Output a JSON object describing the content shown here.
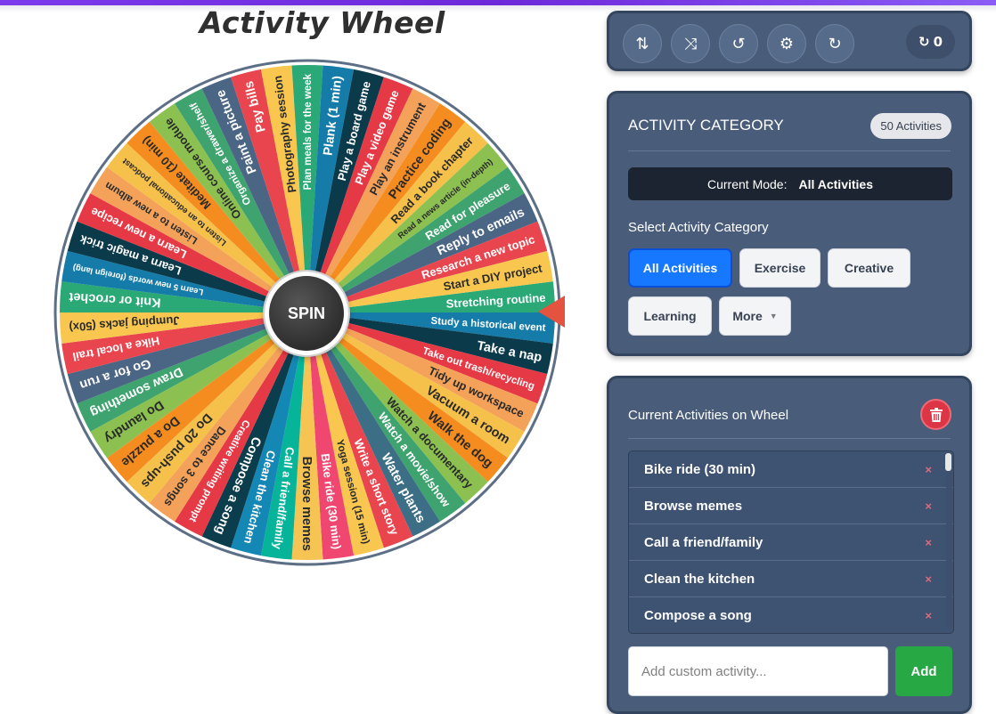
{
  "app": {
    "title": "Activity Wheel"
  },
  "wheel": {
    "spin_label": "SPIN",
    "segments": [
      {
        "label": "Stretching routine",
        "color": "#2aa876"
      },
      {
        "label": "Study a historical event",
        "color": "#157ba8"
      },
      {
        "label": "Take a nap",
        "color": "#0b3a4a"
      },
      {
        "label": "Take out trash/recycling",
        "color": "#e63946"
      },
      {
        "label": "Tidy up workspace",
        "color": "#f4a259"
      },
      {
        "label": "Vacuum a room",
        "color": "#f5c14a"
      },
      {
        "label": "Walk the dog",
        "color": "#f48c1f"
      },
      {
        "label": "Watch a documentary",
        "color": "#8cc152"
      },
      {
        "label": "Watch a movie/show",
        "color": "#3ea36e"
      },
      {
        "label": "Water plants",
        "color": "#3c6e86"
      },
      {
        "label": "Write a short story",
        "color": "#e8454f"
      },
      {
        "label": "Yoga session (15 min)",
        "color": "#f9c74f"
      },
      {
        "label": "Bike ride (30 min)",
        "color": "#ef476f"
      },
      {
        "label": "Browse memes",
        "color": "#f6c453"
      },
      {
        "label": "Call a friend/family",
        "color": "#06b49a"
      },
      {
        "label": "Clean the kitchen",
        "color": "#1587b5"
      },
      {
        "label": "Compose a song",
        "color": "#0b3d4c"
      },
      {
        "label": "Creative writing prompt",
        "color": "#e63946"
      },
      {
        "label": "Dance to 3 songs",
        "color": "#f4a259"
      },
      {
        "label": "Do 20 push-ups",
        "color": "#f5c14a"
      },
      {
        "label": "Do a puzzle",
        "color": "#f48c1f"
      },
      {
        "label": "Do laundry",
        "color": "#8cc152"
      },
      {
        "label": "Draw something",
        "color": "#3ea36e"
      },
      {
        "label": "Go for a run",
        "color": "#4b6584"
      },
      {
        "label": "Hike a local trail",
        "color": "#e8454f"
      },
      {
        "label": "Jumping jacks (50x)",
        "color": "#f9c74f"
      },
      {
        "label": "Knit or crochet",
        "color": "#2aa876"
      },
      {
        "label": "Learn 5 new words (foreign lang)",
        "color": "#157ba8"
      },
      {
        "label": "Learn a magic trick",
        "color": "#0b3a4a"
      },
      {
        "label": "Learn a new recipe",
        "color": "#e63946"
      },
      {
        "label": "Listen to a new album",
        "color": "#f4a259"
      },
      {
        "label": "Listen to an educational podcast",
        "color": "#f5c14a"
      },
      {
        "label": "Meditate (10 min)",
        "color": "#f48c1f"
      },
      {
        "label": "Online course module",
        "color": "#8cc152"
      },
      {
        "label": "Organize a drawer/shelf",
        "color": "#3ea36e"
      },
      {
        "label": "Paint a picture",
        "color": "#4b6584"
      },
      {
        "label": "Pay bills",
        "color": "#e8454f"
      },
      {
        "label": "Photography session",
        "color": "#f9c74f"
      },
      {
        "label": "Plan meals for the week",
        "color": "#2aa876"
      },
      {
        "label": "Plank (1 min)",
        "color": "#157ba8"
      },
      {
        "label": "Play a board game",
        "color": "#0b3a4a"
      },
      {
        "label": "Play a video game",
        "color": "#e63946"
      },
      {
        "label": "Play an instrument",
        "color": "#f4a259"
      },
      {
        "label": "Practice coding",
        "color": "#f48c1f"
      },
      {
        "label": "Read a book chapter",
        "color": "#f5c14a"
      },
      {
        "label": "Read a news article (in-depth)",
        "color": "#8cc152"
      },
      {
        "label": "Read for pleasure",
        "color": "#3ea36e"
      },
      {
        "label": "Reply to emails",
        "color": "#4b6584"
      },
      {
        "label": "Research a new topic",
        "color": "#e8454f"
      },
      {
        "label": "Start a DIY project",
        "color": "#f9c74f"
      }
    ]
  },
  "toolbar": {
    "buttons": [
      {
        "name": "sort-icon",
        "glyph": "⇅"
      },
      {
        "name": "shuffle-icon",
        "glyph": "⤨"
      },
      {
        "name": "history-icon",
        "glyph": "↺"
      },
      {
        "name": "gear-icon",
        "glyph": "⚙"
      },
      {
        "name": "redo-icon",
        "glyph": "↻"
      }
    ],
    "spin_count": "0"
  },
  "category": {
    "title": "ACTIVITY CATEGORY",
    "badge": "50 Activities",
    "mode_label": "Current Mode:",
    "mode_value": "All Activities",
    "select_label": "Select Activity Category",
    "chips": [
      {
        "label": "All Activities"
      },
      {
        "label": "Exercise"
      },
      {
        "label": "Creative"
      },
      {
        "label": "Learning"
      },
      {
        "label": "More"
      }
    ]
  },
  "activities": {
    "title": "Current Activities on Wheel",
    "items": [
      "Bike ride (30 min)",
      "Browse memes",
      "Call a friend/family",
      "Clean the kitchen",
      "Compose a song"
    ],
    "remove_glyph": "×",
    "input_placeholder": "Add custom activity...",
    "add_label": "Add"
  },
  "colors": {
    "panel": "#495d7b",
    "accent_blue": "#1677ff",
    "add_green": "#28a745",
    "delete_red": "#dc3545",
    "pointer": "#e4533f"
  }
}
